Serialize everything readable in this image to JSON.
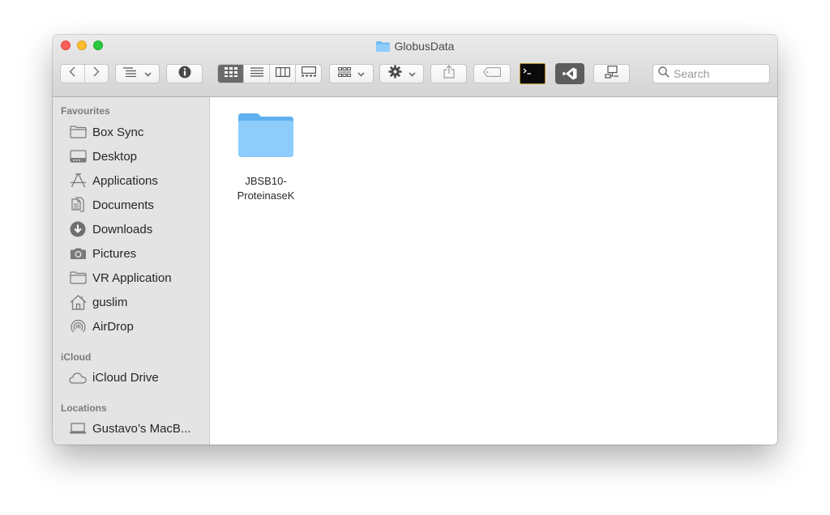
{
  "window": {
    "title": "GlobusData"
  },
  "toolbar": {
    "back_icon": "chevron-left-icon",
    "forward_icon": "chevron-right-icon",
    "sort_icon": "list-sort-icon",
    "info_icon": "info-icon",
    "views": [
      "icon-view-icon",
      "list-view-icon",
      "column-view-icon",
      "gallery-view-icon"
    ],
    "active_view": 0,
    "group_icon": "grid-group-icon",
    "action_icon": "gear-icon",
    "share_icon": "share-icon",
    "tag_icon": "tag-icon",
    "terminal_icon": "terminal-icon",
    "vscode_icon": "vscode-icon",
    "connect_icon": "connect-server-icon"
  },
  "search": {
    "placeholder": "Search"
  },
  "sidebar": {
    "favourites_label": "Favourites",
    "favourites": [
      {
        "label": "Box Sync",
        "icon": "folder-icon"
      },
      {
        "label": "Desktop",
        "icon": "desktop-icon"
      },
      {
        "label": "Applications",
        "icon": "applications-icon"
      },
      {
        "label": "Documents",
        "icon": "documents-icon"
      },
      {
        "label": "Downloads",
        "icon": "downloads-icon"
      },
      {
        "label": "Pictures",
        "icon": "camera-icon"
      },
      {
        "label": "VR Application",
        "icon": "folder-icon"
      },
      {
        "label": "guslim",
        "icon": "home-icon"
      },
      {
        "label": "AirDrop",
        "icon": "airdrop-icon"
      }
    ],
    "icloud_label": "iCloud",
    "icloud": [
      {
        "label": "iCloud Drive",
        "icon": "cloud-icon"
      }
    ],
    "locations_label": "Locations",
    "locations": [
      {
        "label": "Gustavo’s MacB...",
        "icon": "laptop-icon"
      }
    ]
  },
  "content": {
    "items": [
      {
        "line1": "JBSB10-",
        "line2": "ProteinaseK",
        "icon": "folder-icon"
      }
    ]
  },
  "colors": {
    "folder_blue": "#7cc3f6",
    "active_segment": "#6b6b6b",
    "sidebar_bg": "#e4e4e4"
  }
}
